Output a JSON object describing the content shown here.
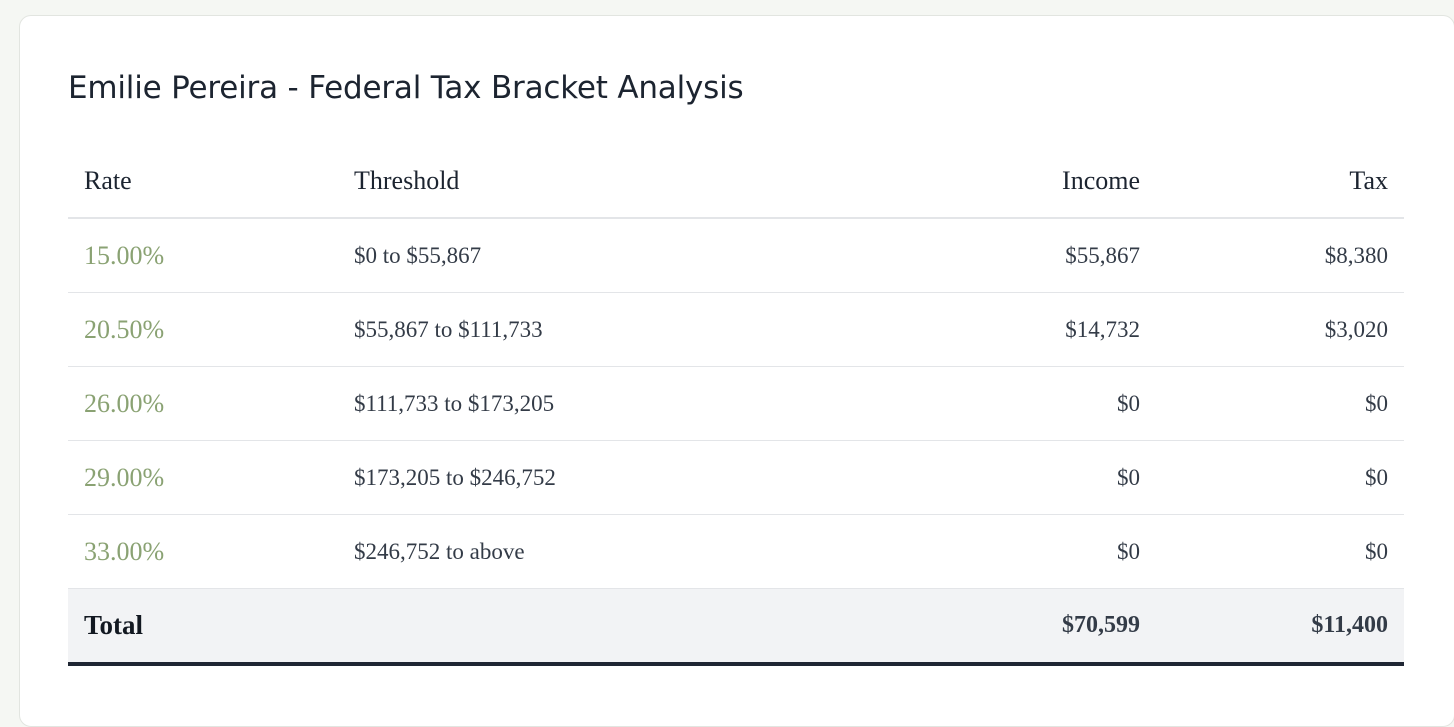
{
  "title": "Emilie Pereira - Federal Tax Bracket Analysis",
  "table": {
    "headers": {
      "rate": "Rate",
      "threshold": "Threshold",
      "income": "Income",
      "tax": "Tax"
    },
    "rows": [
      {
        "rate": "15.00%",
        "threshold": "$0 to $55,867",
        "income": "$55,867",
        "tax": "$8,380"
      },
      {
        "rate": "20.50%",
        "threshold": "$55,867 to $111,733",
        "income": "$14,732",
        "tax": "$3,020"
      },
      {
        "rate": "26.00%",
        "threshold": "$111,733 to $173,205",
        "income": "$0",
        "tax": "$0"
      },
      {
        "rate": "29.00%",
        "threshold": "$173,205 to $246,752",
        "income": "$0",
        "tax": "$0"
      },
      {
        "rate": "33.00%",
        "threshold": "$246,752 to above",
        "income": "$0",
        "tax": "$0"
      }
    ],
    "total": {
      "label": "Total",
      "income": "$70,599",
      "tax": "$11,400"
    }
  },
  "colors": {
    "rate_accent": "#8aa273",
    "total_border": "#1f2633",
    "total_background": "#f2f3f5"
  }
}
